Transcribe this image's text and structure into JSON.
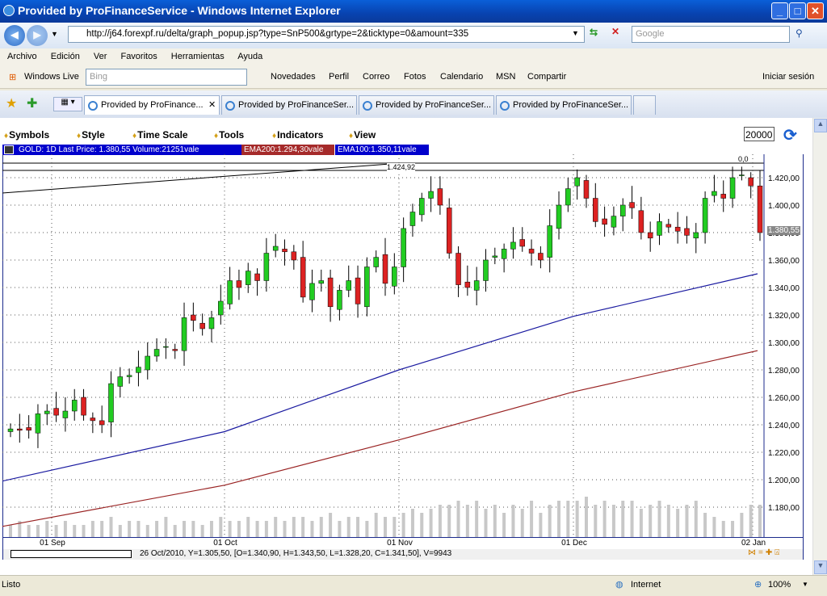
{
  "window": {
    "title": "Provided by ProFinanceService - Windows Internet Explorer",
    "minimize": "_",
    "maximize": "□",
    "close": "✕"
  },
  "address": {
    "url": "http://j64.forexpf.ru/delta/graph_popup.jsp?type=SnP500&grtype=2&ticktype=0&amount=335",
    "search_placeholder": "Google"
  },
  "menu": [
    "Archivo",
    "Edición",
    "Ver",
    "Favoritos",
    "Herramientas",
    "Ayuda"
  ],
  "livebar": {
    "brand": "Windows Live",
    "search_placeholder": "Bing",
    "items": [
      "Novedades",
      "Perfil",
      "Correo",
      "Fotos",
      "Calendario",
      "MSN",
      "Compartir"
    ],
    "signin": "Iniciar sesión"
  },
  "tabs": [
    "Provided by ProFinance...",
    "Provided by ProFinanceSer...",
    "Provided by ProFinanceSer...",
    "Provided by ProFinanceSer..."
  ],
  "chart_menu": {
    "items": [
      "Symbols",
      "Style",
      "Time Scale",
      "Tools",
      "Indicators",
      "View"
    ],
    "amount": "20000"
  },
  "legend": {
    "main": "GOLD: 1D Last Price: 1.380,55 Volume:21251vale",
    "ema200": "EMA200:1.294,30vale",
    "ema100": "EMA100:1.350,11vale"
  },
  "annotations": {
    "trend_label": "1.424,92",
    "top_label": "0,0",
    "last_price": "1.380,55"
  },
  "info": "26 Oct/2010, Y=1.305,50, [O=1.340,90, H=1.343,50, L=1.328,20, C=1.341,50], V=9943",
  "status": {
    "text": "Listo",
    "zone": "Internet",
    "zoom": "100%"
  },
  "colors": {
    "up": "#22cc22",
    "down": "#dd2222",
    "ema100": "#1a1aa0",
    "ema200": "#992222",
    "legend_bg": "#0000cc",
    "ema200_bg": "#a52a2a"
  },
  "chart_data": {
    "type": "candlestick",
    "y_ticks": [
      "1.180,00",
      "1.200,00",
      "1.220,00",
      "1.240,00",
      "1.260,00",
      "1.280,00",
      "1.300,00",
      "1.320,00",
      "1.340,00",
      "1.360,00",
      "1.380,00",
      "1.400,00",
      "1.420,00"
    ],
    "ylim": [
      1170,
      1430
    ],
    "x_ticks": [
      "01 Sep",
      "01 Oct",
      "01 Nov",
      "01 Dec",
      "02 Jan"
    ],
    "close": [
      1237,
      1236,
      1236,
      1248,
      1250,
      1247,
      1250,
      1258,
      1247,
      1243,
      1240,
      1270,
      1275,
      1276,
      1282,
      1290,
      1295,
      1297,
      1294,
      1318,
      1316,
      1310,
      1318,
      1330,
      1345,
      1340,
      1352,
      1345,
      1365,
      1370,
      1366,
      1360,
      1333,
      1343,
      1345,
      1326,
      1338,
      1345,
      1328,
      1355,
      1362,
      1343,
      1355,
      1383,
      1395,
      1405,
      1410,
      1400,
      1365,
      1342,
      1340,
      1345,
      1360,
      1363,
      1368,
      1373,
      1370,
      1365,
      1360,
      1385,
      1400,
      1412,
      1420,
      1405,
      1388,
      1386,
      1392,
      1400,
      1398,
      1380,
      1376,
      1388,
      1384,
      1381,
      1378,
      1380,
      1405,
      1410,
      1405,
      1420,
      1422,
      1414,
      1380
    ],
    "ema100": [
      1199,
      1235,
      1280,
      1319,
      1350
    ],
    "ema200": [
      1166,
      1196,
      1229,
      1264,
      1294
    ],
    "volume": [
      3,
      4,
      3,
      3,
      4,
      3,
      4,
      3,
      3,
      4,
      4,
      5,
      3,
      4,
      4,
      3,
      4,
      5,
      3,
      4,
      4,
      3,
      4,
      5,
      4,
      4,
      5,
      4,
      4,
      5,
      4,
      5,
      5,
      4,
      5,
      6,
      4,
      5,
      5,
      4,
      6,
      5,
      5,
      6,
      7,
      6,
      7,
      8,
      8,
      9,
      8,
      9,
      7,
      8,
      6,
      8,
      7,
      9,
      6,
      8,
      9,
      9,
      9,
      10,
      8,
      9,
      8,
      9,
      9,
      7,
      8,
      9,
      8,
      7,
      8,
      9,
      6,
      5,
      4,
      4,
      6,
      8,
      8
    ]
  }
}
